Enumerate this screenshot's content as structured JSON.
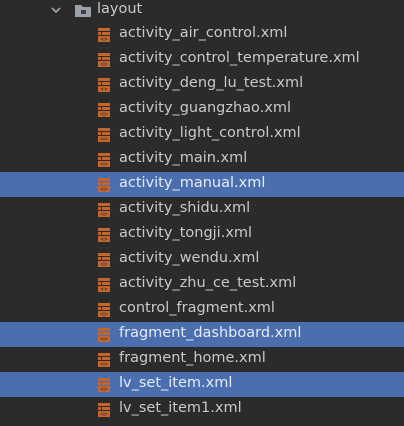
{
  "project_tree": {
    "folder": {
      "label": "layout",
      "icon": "folder-icon",
      "expanded": true
    },
    "files": [
      {
        "name": "activity_air_control.xml",
        "selected": false
      },
      {
        "name": "activity_control_temperature.xml",
        "selected": false
      },
      {
        "name": "activity_deng_lu_test.xml",
        "selected": false
      },
      {
        "name": "activity_guangzhao.xml",
        "selected": false
      },
      {
        "name": "activity_light_control.xml",
        "selected": false
      },
      {
        "name": "activity_main.xml",
        "selected": false
      },
      {
        "name": "activity_manual.xml",
        "selected": true
      },
      {
        "name": "activity_shidu.xml",
        "selected": false
      },
      {
        "name": "activity_tongji.xml",
        "selected": false
      },
      {
        "name": "activity_wendu.xml",
        "selected": false
      },
      {
        "name": "activity_zhu_ce_test.xml",
        "selected": false
      },
      {
        "name": "control_fragment.xml",
        "selected": false
      },
      {
        "name": "fragment_dashboard.xml",
        "selected": true
      },
      {
        "name": "fragment_home.xml",
        "selected": false
      },
      {
        "name": "lv_set_item.xml",
        "selected": true
      },
      {
        "name": "lv_set_item1.xml",
        "selected": false
      }
    ],
    "file_icon": "xml-layout-file-icon",
    "colors": {
      "background": "#2b2b2b",
      "selection": "#4b6eaf",
      "text": "#c9c9c9",
      "file_icon": "#c4652e"
    }
  }
}
